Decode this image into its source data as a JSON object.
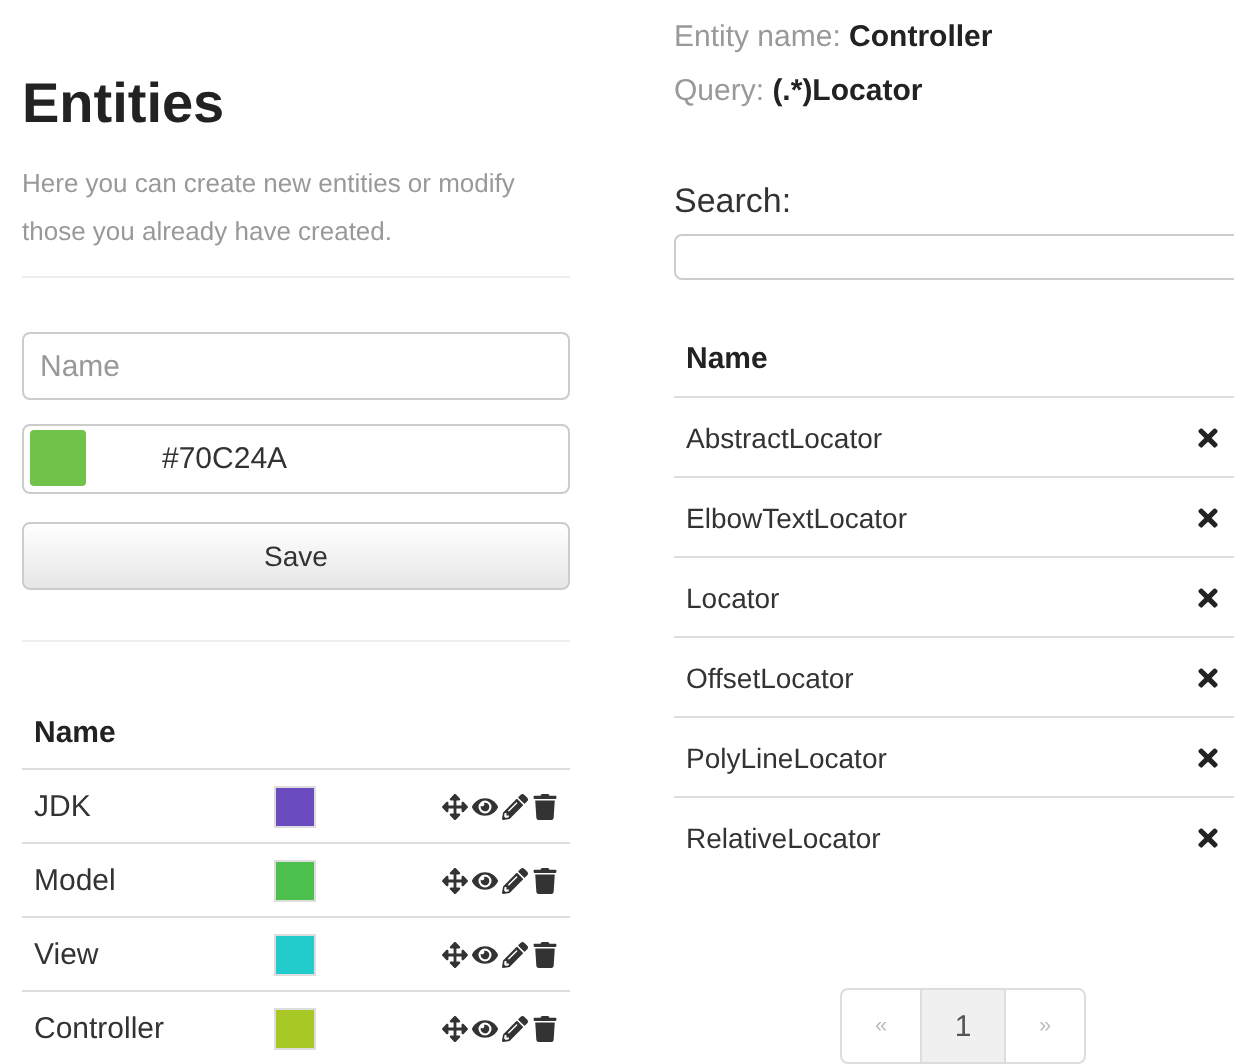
{
  "entities_panel": {
    "title": "Entities",
    "description": "Here you can create new entities or modify those you already have created.",
    "name_field": {
      "placeholder": "Name"
    },
    "color_field": {
      "value": "#70C24A",
      "color": "#70c24a"
    },
    "save_button": "Save",
    "table": {
      "columns": [
        "Name"
      ],
      "rows": [
        {
          "name": "JDK",
          "color": "#6b4cc0"
        },
        {
          "name": "Model",
          "color": "#4cc04c"
        },
        {
          "name": "View",
          "color": "#22cccc"
        },
        {
          "name": "Controller",
          "color": "#a8c826"
        }
      ]
    }
  },
  "detail_panel": {
    "entity_label": "Entity name:",
    "entity_value": "Controller",
    "query_label": "Query:",
    "query_value": "(.*)Locator",
    "search": {
      "label": "Search:"
    },
    "table": {
      "columns": [
        "Name"
      ],
      "rows": [
        "AbstractLocator",
        "ElbowTextLocator",
        "Locator",
        "OffsetLocator",
        "PolyLineLocator",
        "RelativeLocator"
      ]
    },
    "pagination": [
      {
        "label": "«",
        "kind": "prev",
        "selected": false,
        "disabled": true
      },
      {
        "label": "1",
        "kind": "page",
        "selected": true,
        "disabled": false
      },
      {
        "label": "»",
        "kind": "next",
        "selected": false,
        "disabled": true
      }
    ]
  }
}
